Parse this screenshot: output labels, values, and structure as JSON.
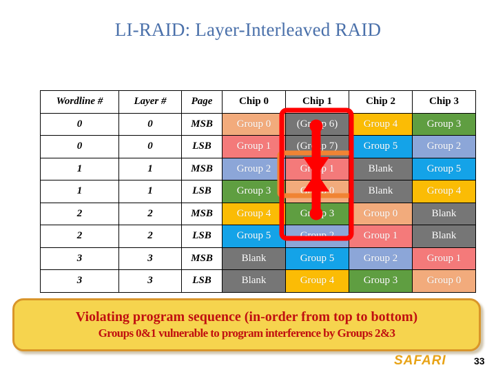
{
  "slide": {
    "title": "LI-RAID: Layer-Interleaved RAID",
    "title_color": "#4a70aa",
    "page_number": "33",
    "brand": "SAFARI",
    "brand_color": "#e8a317"
  },
  "table": {
    "headers": [
      "Wordline #",
      "Layer #",
      "Page",
      "Chip 0",
      "Chip 1",
      "Chip 2",
      "Chip 3"
    ],
    "rows": [
      {
        "wordline": "0",
        "layer": "0",
        "page": "MSB",
        "chips": [
          {
            "label": "Group 0",
            "color": "#f2ab7c"
          },
          {
            "label": "(Group 6)",
            "color": "#767676"
          },
          {
            "label": "Group 4",
            "color": "#fbbc05"
          },
          {
            "label": "Group 3",
            "color": "#5f9e41"
          }
        ]
      },
      {
        "wordline": "0",
        "layer": "0",
        "page": "LSB",
        "chips": [
          {
            "label": "Group 1",
            "color": "#f47a7a"
          },
          {
            "label": "(Group 7)",
            "color": "#767676"
          },
          {
            "label": "Group 5",
            "color": "#14a3e8"
          },
          {
            "label": "Group 2",
            "color": "#8ca6d8"
          }
        ]
      },
      {
        "wordline": "1",
        "layer": "1",
        "page": "MSB",
        "chips": [
          {
            "label": "Group 2",
            "color": "#8ca6d8"
          },
          {
            "label": "Group 1",
            "color": "#f47a7a"
          },
          {
            "label": "Blank",
            "color": "#767676"
          },
          {
            "label": "Group 5",
            "color": "#14a3e8"
          }
        ]
      },
      {
        "wordline": "1",
        "layer": "1",
        "page": "LSB",
        "chips": [
          {
            "label": "Group 3",
            "color": "#5f9e41"
          },
          {
            "label": "Group 0",
            "color": "#f2ab7c"
          },
          {
            "label": "Blank",
            "color": "#767676"
          },
          {
            "label": "Group 4",
            "color": "#fbbc05"
          }
        ]
      },
      {
        "wordline": "2",
        "layer": "2",
        "page": "MSB",
        "chips": [
          {
            "label": "Group 4",
            "color": "#fbbc05"
          },
          {
            "label": "Group 3",
            "color": "#5f9e41"
          },
          {
            "label": "Group 0",
            "color": "#f2ab7c"
          },
          {
            "label": "Blank",
            "color": "#767676"
          }
        ]
      },
      {
        "wordline": "2",
        "layer": "2",
        "page": "LSB",
        "chips": [
          {
            "label": "Group 5",
            "color": "#14a3e8"
          },
          {
            "label": "Group 2",
            "color": "#8ca6d8"
          },
          {
            "label": "Group 1",
            "color": "#f47a7a"
          },
          {
            "label": "Blank",
            "color": "#767676"
          }
        ]
      },
      {
        "wordline": "3",
        "layer": "3",
        "page": "MSB",
        "chips": [
          {
            "label": "Blank",
            "color": "#767676"
          },
          {
            "label": "Group 5",
            "color": "#14a3e8"
          },
          {
            "label": "Group 2",
            "color": "#8ca6d8"
          },
          {
            "label": "Group 1",
            "color": "#f47a7a"
          }
        ]
      },
      {
        "wordline": "3",
        "layer": "3",
        "page": "LSB",
        "chips": [
          {
            "label": "Blank",
            "color": "#767676"
          },
          {
            "label": "Group 4",
            "color": "#fbbc05"
          },
          {
            "label": "Group 3",
            "color": "#5f9e41"
          },
          {
            "label": "Group 0",
            "color": "#f2ab7c"
          }
        ]
      }
    ]
  },
  "annotations": {
    "highlight_outline_color": "#ff0000",
    "highlight_inner_color": "#f08434",
    "arrow_color": "#ff0000"
  },
  "callout": {
    "line1": "Violating program sequence (in-order from top to bottom)",
    "line2": "Groups 0&1 vulnerable to program interference by Groups 2&3",
    "text_color": "#c01010",
    "fill_color": "#f6d44e",
    "border_color": "#d9952a"
  }
}
